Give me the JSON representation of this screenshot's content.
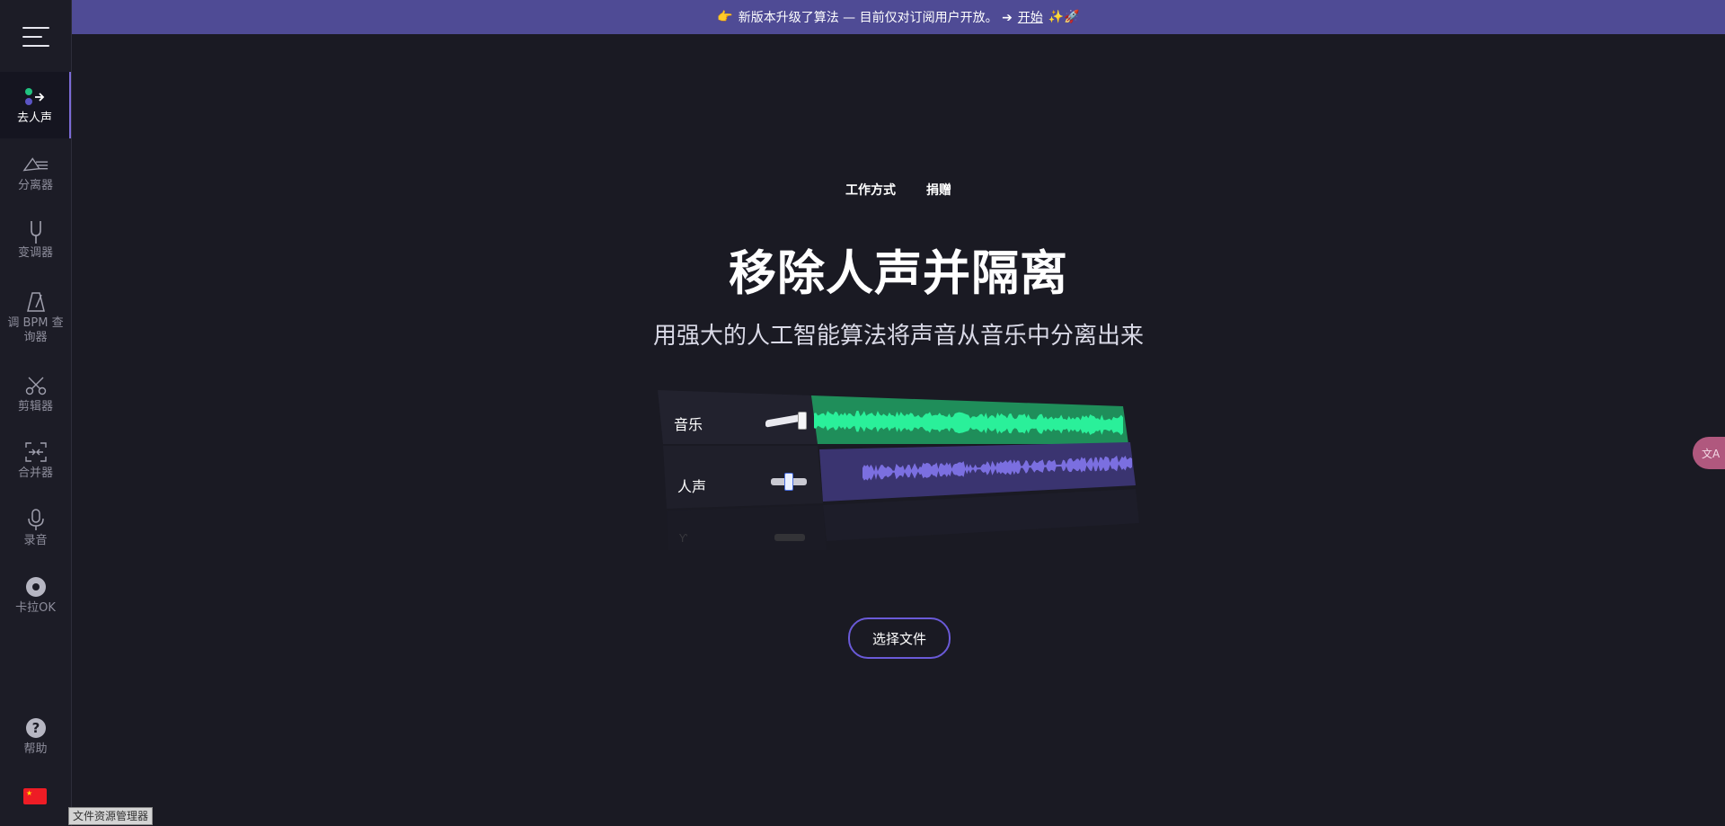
{
  "banner": {
    "prefix_icon": "👉",
    "text": "新版本升级了算法 — 目前仅对订阅用户开放。 ➔",
    "link": "开始",
    "suffix_icons": "✨🚀"
  },
  "sidebar": {
    "items": [
      {
        "label": "去人声",
        "icon": "vocal-remover-icon"
      },
      {
        "label": "分离器",
        "icon": "splitter-icon"
      },
      {
        "label": "变调器",
        "icon": "tuning-fork-icon"
      },
      {
        "label": "调 BPM 查询器",
        "icon": "metronome-icon"
      },
      {
        "label": "剪辑器",
        "icon": "scissors-icon"
      },
      {
        "label": "合并器",
        "icon": "joiner-icon"
      },
      {
        "label": "录音",
        "icon": "microphone-icon"
      },
      {
        "label": "卡拉OK",
        "icon": "disc-icon"
      }
    ],
    "help_label": "帮助",
    "flag": "china-flag-icon"
  },
  "top_links": [
    "工作方式",
    "捐赠"
  ],
  "hero": {
    "title": "移除人声并隔离",
    "subtitle": "用强大的人工智能算法将声音从音乐中分离出来"
  },
  "illustration": {
    "music_label": "音乐",
    "vocal_label": "人声",
    "music_volume": 1.0,
    "vocal_volume": 0.35,
    "colors": {
      "music": "#1ee38a",
      "vocal": "#7b6fe0"
    }
  },
  "choose_file_label": "选择文件",
  "translate_icon": "translate-icon",
  "tooltip": "文件资源管理器",
  "colors": {
    "accent": "#6a5ad8",
    "banner": "#4f4b95",
    "background": "#1a1a23"
  }
}
